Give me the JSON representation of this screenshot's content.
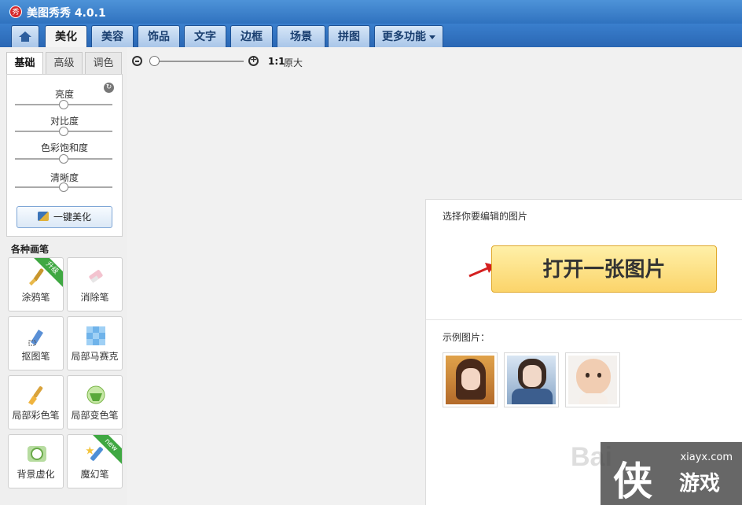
{
  "app": {
    "logo_char": "秀",
    "title": "美图秀秀 4.0.1"
  },
  "tabs": [
    {
      "label": "美化",
      "active": true
    },
    {
      "label": "美容"
    },
    {
      "label": "饰品"
    },
    {
      "label": "文字"
    },
    {
      "label": "边框"
    },
    {
      "label": "场景"
    },
    {
      "label": "拼图"
    },
    {
      "label": "更多功能"
    }
  ],
  "subtabs": [
    "基础",
    "高级",
    "调色"
  ],
  "adjustments": [
    {
      "label": "亮度",
      "level": 0.5
    },
    {
      "label": "对比度",
      "level": 0.5
    },
    {
      "label": "色彩饱和度",
      "level": 0.5
    },
    {
      "label": "清晰度",
      "level": 0.5
    }
  ],
  "one_click_label": "一键美化",
  "brush_heading": "各种画笔",
  "tools": [
    {
      "label": "涂鸦笔",
      "badge": "升级",
      "icon": "brush-icon"
    },
    {
      "label": "消除笔",
      "icon": "eraser-icon"
    },
    {
      "label": "抠图笔",
      "icon": "cutout-pen-icon"
    },
    {
      "label": "局部马赛克",
      "icon": "mosaic-icon"
    },
    {
      "label": "局部彩色笔",
      "icon": "color-brush-icon"
    },
    {
      "label": "局部变色笔",
      "icon": "color-change-icon"
    },
    {
      "label": "背景虚化",
      "icon": "blur-icon"
    },
    {
      "label": "魔幻笔",
      "badge": "new",
      "icon": "magic-pen-icon"
    }
  ],
  "zoom": {
    "ratio_label": "1:1",
    "original_label": "原大",
    "level": 0.0
  },
  "open_panel": {
    "title": "选择你要编辑的图片",
    "open_button": "打开一张图片",
    "samples_label": "示例图片：",
    "samples": [
      "sample-photo-1",
      "sample-photo-2",
      "sample-photo-3"
    ]
  },
  "watermark": {
    "baidu_text": "Bai",
    "domain": "xiayx.com",
    "brand": "游戏",
    "logo_char": "侠"
  },
  "colors": {
    "titlebar": "#2f72bf",
    "accent_button": "#fbd46a",
    "badge_green": "#3fa842",
    "arrow_red": "#d42020"
  }
}
